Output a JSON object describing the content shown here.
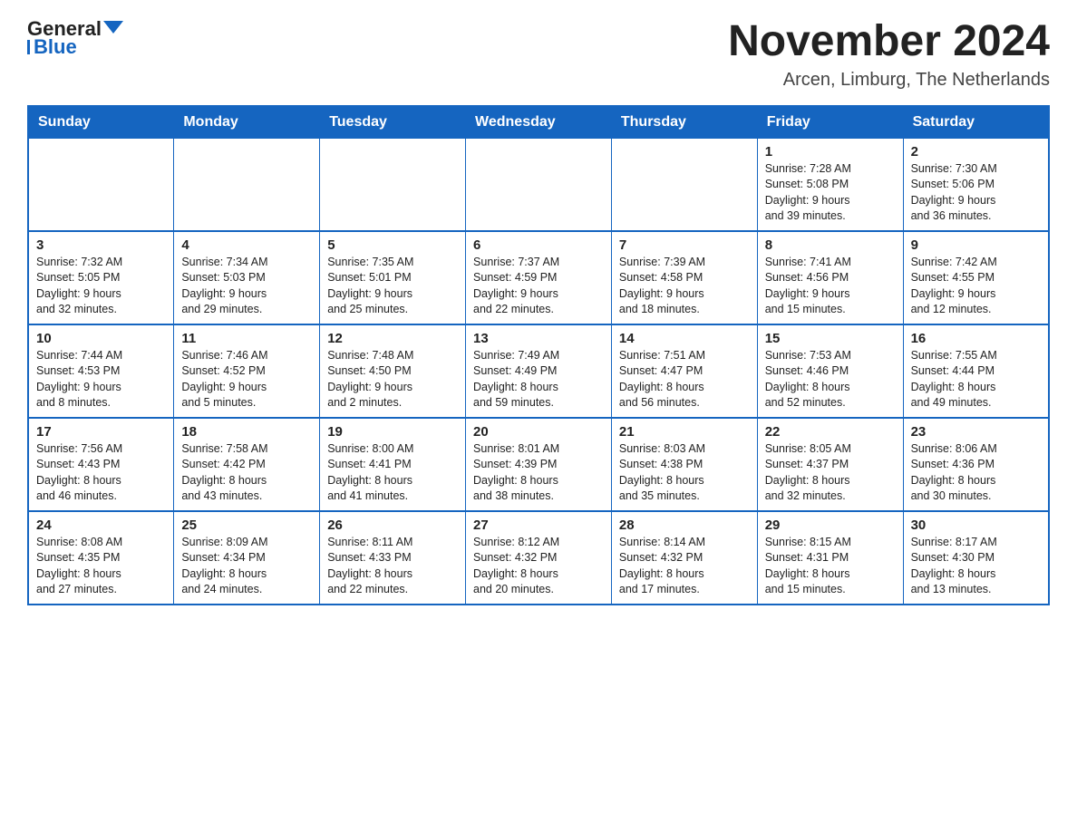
{
  "logo": {
    "text1": "General",
    "text2": "Blue"
  },
  "header": {
    "month": "November 2024",
    "location": "Arcen, Limburg, The Netherlands"
  },
  "weekdays": [
    "Sunday",
    "Monday",
    "Tuesday",
    "Wednesday",
    "Thursday",
    "Friday",
    "Saturday"
  ],
  "weeks": [
    [
      {
        "day": "",
        "info": ""
      },
      {
        "day": "",
        "info": ""
      },
      {
        "day": "",
        "info": ""
      },
      {
        "day": "",
        "info": ""
      },
      {
        "day": "",
        "info": ""
      },
      {
        "day": "1",
        "info": "Sunrise: 7:28 AM\nSunset: 5:08 PM\nDaylight: 9 hours\nand 39 minutes."
      },
      {
        "day": "2",
        "info": "Sunrise: 7:30 AM\nSunset: 5:06 PM\nDaylight: 9 hours\nand 36 minutes."
      }
    ],
    [
      {
        "day": "3",
        "info": "Sunrise: 7:32 AM\nSunset: 5:05 PM\nDaylight: 9 hours\nand 32 minutes."
      },
      {
        "day": "4",
        "info": "Sunrise: 7:34 AM\nSunset: 5:03 PM\nDaylight: 9 hours\nand 29 minutes."
      },
      {
        "day": "5",
        "info": "Sunrise: 7:35 AM\nSunset: 5:01 PM\nDaylight: 9 hours\nand 25 minutes."
      },
      {
        "day": "6",
        "info": "Sunrise: 7:37 AM\nSunset: 4:59 PM\nDaylight: 9 hours\nand 22 minutes."
      },
      {
        "day": "7",
        "info": "Sunrise: 7:39 AM\nSunset: 4:58 PM\nDaylight: 9 hours\nand 18 minutes."
      },
      {
        "day": "8",
        "info": "Sunrise: 7:41 AM\nSunset: 4:56 PM\nDaylight: 9 hours\nand 15 minutes."
      },
      {
        "day": "9",
        "info": "Sunrise: 7:42 AM\nSunset: 4:55 PM\nDaylight: 9 hours\nand 12 minutes."
      }
    ],
    [
      {
        "day": "10",
        "info": "Sunrise: 7:44 AM\nSunset: 4:53 PM\nDaylight: 9 hours\nand 8 minutes."
      },
      {
        "day": "11",
        "info": "Sunrise: 7:46 AM\nSunset: 4:52 PM\nDaylight: 9 hours\nand 5 minutes."
      },
      {
        "day": "12",
        "info": "Sunrise: 7:48 AM\nSunset: 4:50 PM\nDaylight: 9 hours\nand 2 minutes."
      },
      {
        "day": "13",
        "info": "Sunrise: 7:49 AM\nSunset: 4:49 PM\nDaylight: 8 hours\nand 59 minutes."
      },
      {
        "day": "14",
        "info": "Sunrise: 7:51 AM\nSunset: 4:47 PM\nDaylight: 8 hours\nand 56 minutes."
      },
      {
        "day": "15",
        "info": "Sunrise: 7:53 AM\nSunset: 4:46 PM\nDaylight: 8 hours\nand 52 minutes."
      },
      {
        "day": "16",
        "info": "Sunrise: 7:55 AM\nSunset: 4:44 PM\nDaylight: 8 hours\nand 49 minutes."
      }
    ],
    [
      {
        "day": "17",
        "info": "Sunrise: 7:56 AM\nSunset: 4:43 PM\nDaylight: 8 hours\nand 46 minutes."
      },
      {
        "day": "18",
        "info": "Sunrise: 7:58 AM\nSunset: 4:42 PM\nDaylight: 8 hours\nand 43 minutes."
      },
      {
        "day": "19",
        "info": "Sunrise: 8:00 AM\nSunset: 4:41 PM\nDaylight: 8 hours\nand 41 minutes."
      },
      {
        "day": "20",
        "info": "Sunrise: 8:01 AM\nSunset: 4:39 PM\nDaylight: 8 hours\nand 38 minutes."
      },
      {
        "day": "21",
        "info": "Sunrise: 8:03 AM\nSunset: 4:38 PM\nDaylight: 8 hours\nand 35 minutes."
      },
      {
        "day": "22",
        "info": "Sunrise: 8:05 AM\nSunset: 4:37 PM\nDaylight: 8 hours\nand 32 minutes."
      },
      {
        "day": "23",
        "info": "Sunrise: 8:06 AM\nSunset: 4:36 PM\nDaylight: 8 hours\nand 30 minutes."
      }
    ],
    [
      {
        "day": "24",
        "info": "Sunrise: 8:08 AM\nSunset: 4:35 PM\nDaylight: 8 hours\nand 27 minutes."
      },
      {
        "day": "25",
        "info": "Sunrise: 8:09 AM\nSunset: 4:34 PM\nDaylight: 8 hours\nand 24 minutes."
      },
      {
        "day": "26",
        "info": "Sunrise: 8:11 AM\nSunset: 4:33 PM\nDaylight: 8 hours\nand 22 minutes."
      },
      {
        "day": "27",
        "info": "Sunrise: 8:12 AM\nSunset: 4:32 PM\nDaylight: 8 hours\nand 20 minutes."
      },
      {
        "day": "28",
        "info": "Sunrise: 8:14 AM\nSunset: 4:32 PM\nDaylight: 8 hours\nand 17 minutes."
      },
      {
        "day": "29",
        "info": "Sunrise: 8:15 AM\nSunset: 4:31 PM\nDaylight: 8 hours\nand 15 minutes."
      },
      {
        "day": "30",
        "info": "Sunrise: 8:17 AM\nSunset: 4:30 PM\nDaylight: 8 hours\nand 13 minutes."
      }
    ]
  ]
}
